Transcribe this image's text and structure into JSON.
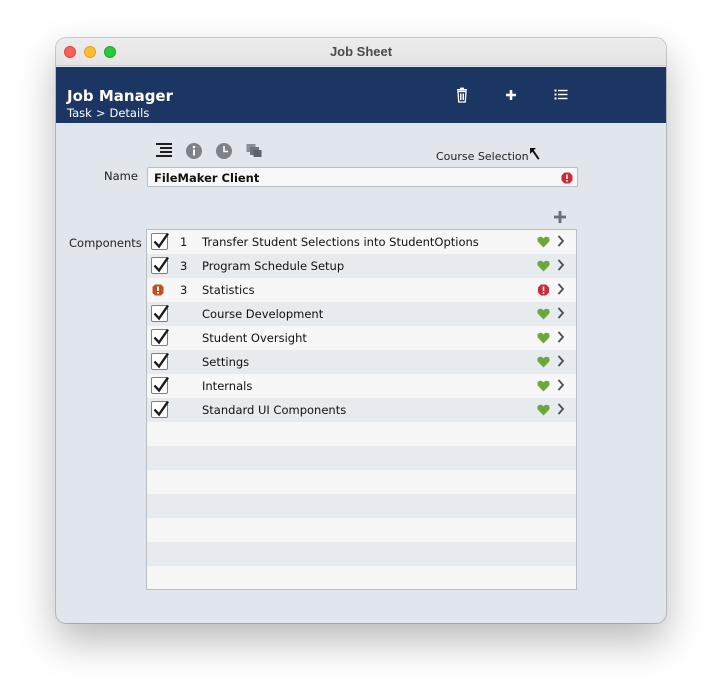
{
  "window": {
    "title": "Job Sheet"
  },
  "header": {
    "app_title": "Job Manager",
    "breadcrumb": [
      "Task",
      ">",
      "Details"
    ]
  },
  "toolbar": {
    "icons": [
      "indent-icon",
      "info-icon",
      "clock-icon",
      "copy-icon"
    ],
    "course_selection_label": "Course Selection"
  },
  "form": {
    "name_label": "Name",
    "name_value": "FileMaker Client",
    "components_label": "Components"
  },
  "components": [
    {
      "check": "checked",
      "num": "1",
      "name": "Transfer Student Selections into StudentOptions",
      "status": "ok"
    },
    {
      "check": "checked",
      "num": "3",
      "name": "Program Schedule Setup",
      "status": "ok"
    },
    {
      "check": "warning",
      "num": "3",
      "name": "Statistics",
      "status": "error"
    },
    {
      "check": "checked",
      "num": "",
      "name": "Course Development",
      "status": "ok"
    },
    {
      "check": "checked",
      "num": "",
      "name": "Student Oversight",
      "status": "ok"
    },
    {
      "check": "checked",
      "num": "",
      "name": "Settings",
      "status": "ok"
    },
    {
      "check": "checked",
      "num": "",
      "name": "Internals",
      "status": "ok"
    },
    {
      "check": "checked",
      "num": "",
      "name": "Standard UI Components",
      "status": "ok"
    }
  ],
  "colors": {
    "header_bg": "#1c3664",
    "ok_heart": "#6aa83a",
    "error_red": "#cc2a3c",
    "warning_orange": "#c2501f"
  }
}
